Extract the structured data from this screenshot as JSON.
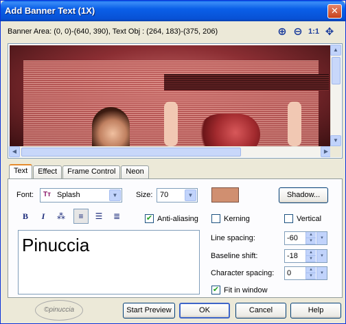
{
  "window": {
    "title": "Add Banner Text (1X)",
    "close_glyph": "✕"
  },
  "info": {
    "text": "Banner Area: (0, 0)-(640, 390), Text Obj : (264, 183)-(375, 206)"
  },
  "zoom": {
    "zoom_in_glyph": "⊕",
    "zoom_out_glyph": "⊖",
    "actual_size": "1:1",
    "fit_glyph": "✥"
  },
  "tabs": [
    {
      "label": "Text"
    },
    {
      "label": "Effect"
    },
    {
      "label": "Frame Control"
    },
    {
      "label": "Neon"
    }
  ],
  "text_tab": {
    "font_label": "Font:",
    "font_icon": "Tт",
    "font_value": "Splash",
    "size_label": "Size:",
    "size_value": "70",
    "text_color": "#d08f70",
    "shadow_button": "Shadow...",
    "bold": "B",
    "italic": "I",
    "anti_aliasing_label": "Anti-aliasing",
    "kerning_label": "Kerning",
    "vertical_label": "Vertical",
    "text_content": "Pinuccia",
    "line_spacing_label": "Line spacing:",
    "line_spacing_value": "-60",
    "baseline_shift_label": "Baseline shift:",
    "baseline_shift_value": "-18",
    "char_spacing_label": "Character spacing:",
    "char_spacing_value": "0",
    "fit_in_window_label": "Fit in window",
    "checked_mark": "✔"
  },
  "buttons": {
    "start_preview": "Start Preview",
    "ok": "OK",
    "cancel": "Cancel",
    "help": "Help"
  },
  "logo_text": "©pinuccia"
}
